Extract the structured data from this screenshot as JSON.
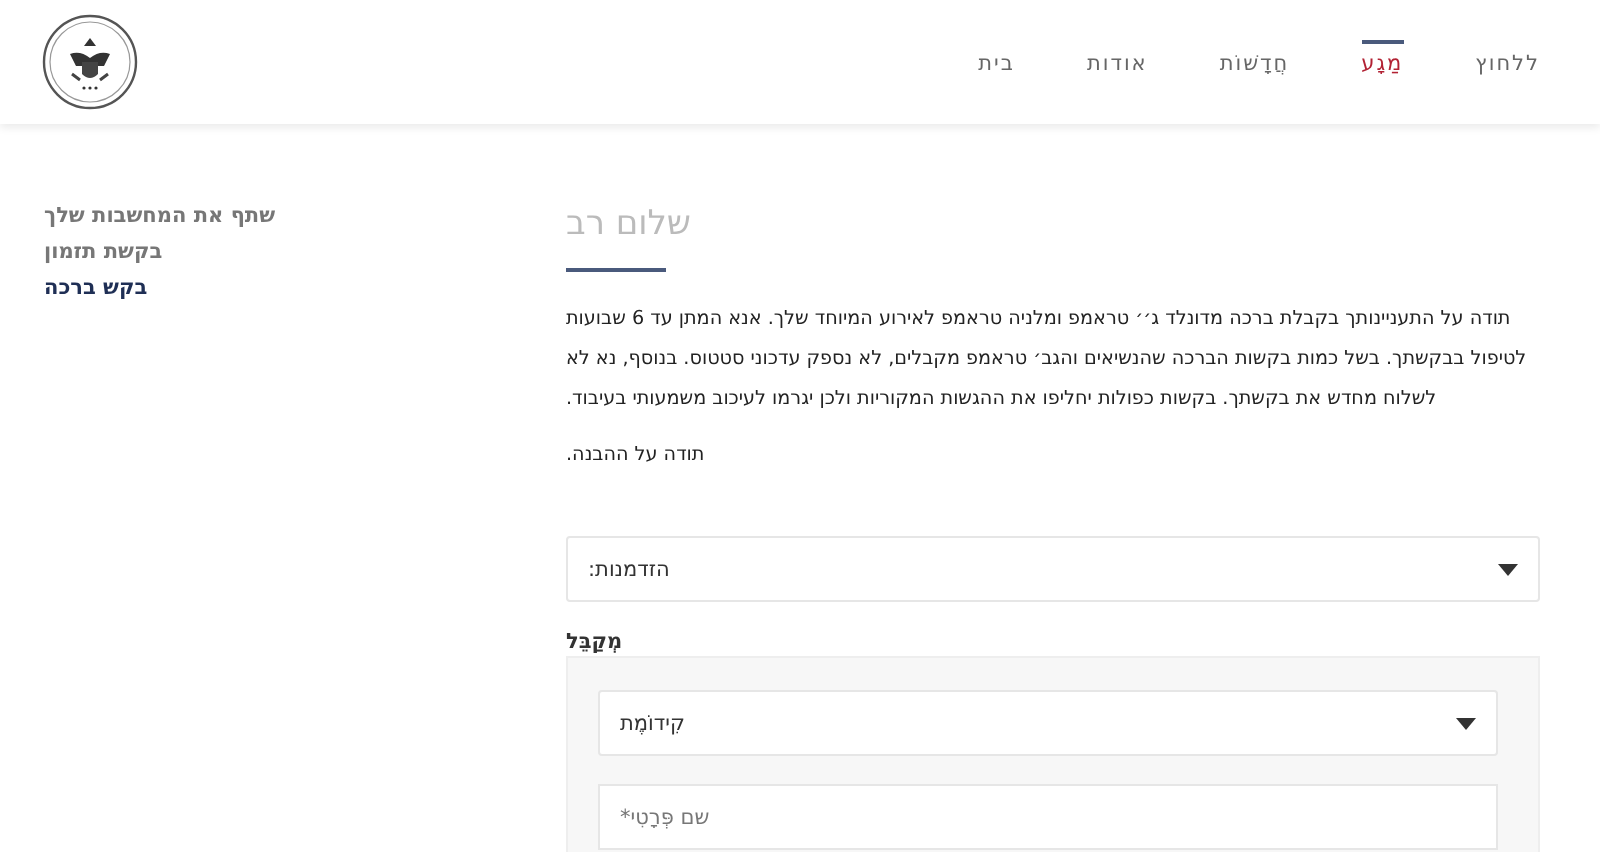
{
  "nav": [
    {
      "label": "ללחוץ",
      "selected": false
    },
    {
      "label": "מַגָע",
      "selected": true
    },
    {
      "label": "חֲדָשׁוֹת",
      "selected": false
    },
    {
      "label": "אודות",
      "selected": false
    },
    {
      "label": "בית",
      "selected": false
    }
  ],
  "sidebar": {
    "items": [
      {
        "label": "שתף את המחשבות שלך",
        "selected": false
      },
      {
        "label": "בקשת תזמון",
        "selected": false
      },
      {
        "label": "בקש ברכה",
        "selected": true
      }
    ]
  },
  "content": {
    "heading": "שלום רב",
    "paragraphs": [
      "תודה על התעניינותך בקבלת ברכה מדונלד ג׳׳ טראמפ ומלניה טראמפ לאירוע המיוחד שלך. אנא המתן עד 6 שבועות לטיפול בבקשתך. בשל כמות בקשות הברכה שהנשיאים והגב׳ טראמפ מקבלים, לא נספק עדכוני סטטוס. בנוסף, נא לא לשלוח מחדש את בקשתך. בקשות כפולות יחליפו את ההגשות המקוריות ולכן יגרמו לעיכוב משמעותי בעיבוד.",
      "תודה על ההבנה."
    ],
    "occasion_select": {
      "value": "הזדמנות:"
    },
    "recipient": {
      "legend": "מְקַבֵּל",
      "prefix_select": {
        "value": "קִידוֹמֶת"
      },
      "first_name": {
        "placeholder": "שם פְּרָטִי*"
      }
    }
  }
}
